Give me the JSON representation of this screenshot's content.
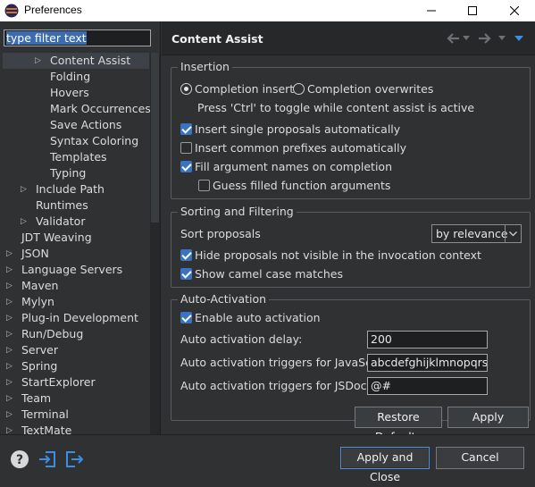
{
  "window": {
    "title": "Preferences"
  },
  "filter": {
    "value": "type filter text"
  },
  "tree": [
    {
      "label": "Content Assist",
      "indent": 2,
      "arrow": true,
      "selected": true
    },
    {
      "label": "Folding",
      "indent": 2,
      "arrow": false
    },
    {
      "label": "Hovers",
      "indent": 2,
      "arrow": false
    },
    {
      "label": "Mark Occurrences",
      "indent": 2,
      "arrow": false
    },
    {
      "label": "Save Actions",
      "indent": 2,
      "arrow": false
    },
    {
      "label": "Syntax Coloring",
      "indent": 2,
      "arrow": false
    },
    {
      "label": "Templates",
      "indent": 2,
      "arrow": false
    },
    {
      "label": "Typing",
      "indent": 2,
      "arrow": false
    },
    {
      "label": "Include Path",
      "indent": 1,
      "arrow": true
    },
    {
      "label": "Runtimes",
      "indent": 1,
      "arrow": false
    },
    {
      "label": "Validator",
      "indent": 1,
      "arrow": true
    },
    {
      "label": "JDT Weaving",
      "indent": 0,
      "arrow": false
    },
    {
      "label": "JSON",
      "indent": 0,
      "arrow": true
    },
    {
      "label": "Language Servers",
      "indent": 0,
      "arrow": true
    },
    {
      "label": "Maven",
      "indent": 0,
      "arrow": true
    },
    {
      "label": "Mylyn",
      "indent": 0,
      "arrow": true
    },
    {
      "label": "Plug-in Development",
      "indent": 0,
      "arrow": true
    },
    {
      "label": "Run/Debug",
      "indent": 0,
      "arrow": true
    },
    {
      "label": "Server",
      "indent": 0,
      "arrow": true
    },
    {
      "label": "Spring",
      "indent": 0,
      "arrow": true
    },
    {
      "label": "StartExplorer",
      "indent": 0,
      "arrow": true
    },
    {
      "label": "Team",
      "indent": 0,
      "arrow": true
    },
    {
      "label": "Terminal",
      "indent": 0,
      "arrow": true
    },
    {
      "label": "TextMate",
      "indent": 0,
      "arrow": true
    }
  ],
  "page": {
    "title": "Content Assist",
    "insertion": {
      "legend": "Insertion",
      "radio_inserts": "Completion inserts",
      "radio_overwrites": "Completion overwrites",
      "toggle_hint": "Press 'Ctrl' to toggle while content assist is active",
      "single_proposals": "Insert single proposals automatically",
      "common_prefixes": "Insert common prefixes automatically",
      "fill_arguments": "Fill argument names on completion",
      "guess_arguments": "Guess filled function arguments"
    },
    "sorting": {
      "legend": "Sorting and Filtering",
      "sort_label": "Sort proposals",
      "sort_value": "by relevance",
      "hide_not_visible": "Hide proposals not visible in the invocation context",
      "camel_case": "Show camel case matches"
    },
    "auto": {
      "legend": "Auto-Activation",
      "enable": "Enable auto activation",
      "delay_label": "Auto activation delay:",
      "delay_value": "200",
      "js_label": "Auto activation triggers for JavaScript:",
      "js_value": "abcdefghijklmnopqrstuvwxyz",
      "jsdoc_label": "Auto activation triggers for JSDoc:",
      "jsdoc_value": "@#"
    },
    "restore_defaults": "Restore Defaults",
    "apply": "Apply"
  },
  "footer": {
    "apply_close": "Apply and Close",
    "cancel": "Cancel"
  },
  "colors": {
    "accent": "#3b73c3",
    "background": "#2f3133",
    "header": "#26282a"
  }
}
